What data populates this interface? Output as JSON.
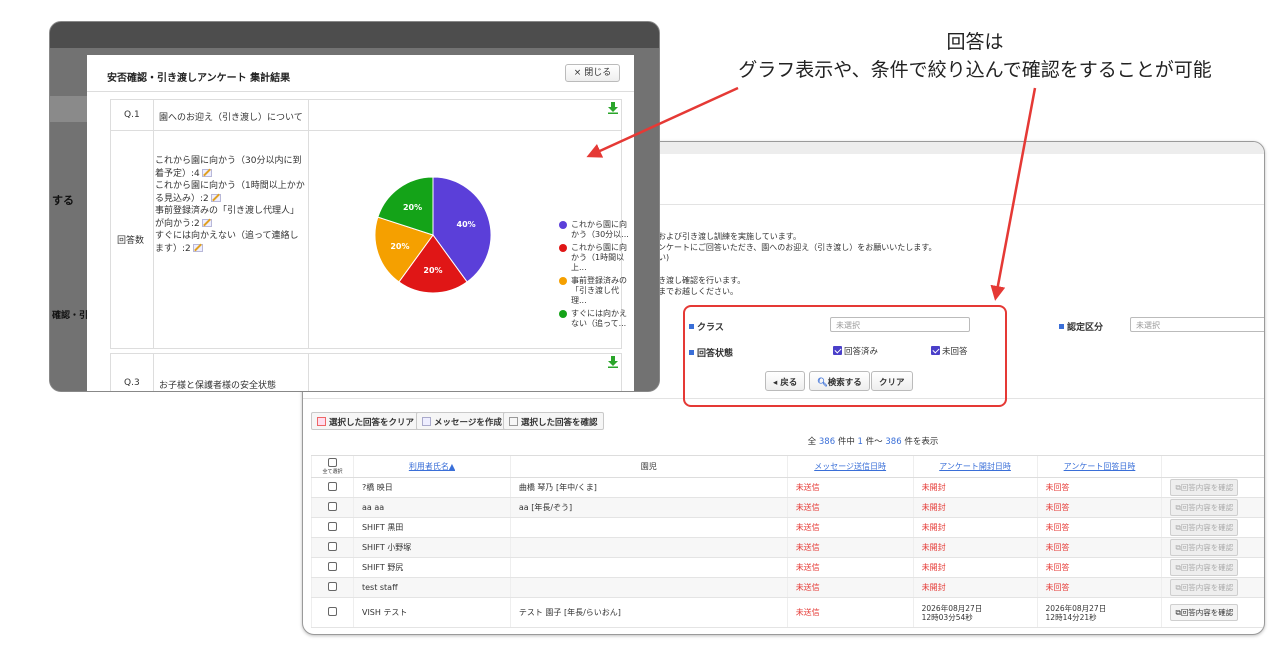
{
  "annotation": {
    "line1": "回答は",
    "line2": "グラフ表示や、条件で絞り込んで確認をすることが可能"
  },
  "colors": {
    "accent": "#e53935",
    "link": "#3a6fd8",
    "purple": "#4a3fc9"
  },
  "list_screen": {
    "info_lines": [
      "および引き渡し訓練を実施しています。",
      "ンケートにご回答いただき、園へのお迎え（引き渡し）をお願いいたします。",
      "い)"
    ],
    "info_lines2": [
      "き渡し確認を行います。",
      "までお越しください。"
    ],
    "filter": {
      "class_label": "クラス",
      "class_placeholder": "未選択",
      "cert_label": "認定区分",
      "cert_placeholder": "未選択",
      "status_label": "回答状態",
      "answered": "回答済み",
      "unanswered": "未回答",
      "back": "戻る",
      "search": "検索する",
      "clear": "クリア"
    },
    "toolbar": {
      "clear_selected": "選択した回答をクリア",
      "create_message": "メッセージを作成",
      "confirm_selected": "選択した回答を確認"
    },
    "count": {
      "pre": "全",
      "total": "386",
      "mid1": "件中",
      "from": "1",
      "mid2": "件～",
      "to": "386",
      "post": "件を表示"
    },
    "columns": {
      "select_all": "全て選択",
      "user_name": "利用者氏名▲",
      "child": "園児",
      "msg_sent": "メッセージ送信日時",
      "opened": "アンケート開封日時",
      "answered_at": "アンケート回答日時"
    },
    "rows": [
      {
        "name": "?橋 映日",
        "child": "曲橋 琴乃 [年中/くま]",
        "sent": "未送信",
        "opened": "未開封",
        "answered": "未回答",
        "btn": "回答内容を確認"
      },
      {
        "name": "aa aa",
        "child": "aa [年長/ぞう]",
        "sent": "未送信",
        "opened": "未開封",
        "answered": "未回答",
        "btn": "回答内容を確認"
      },
      {
        "name": "SHIFT 黒田",
        "child": "",
        "sent": "未送信",
        "opened": "未開封",
        "answered": "未回答",
        "btn": "回答内容を確認"
      },
      {
        "name": "SHIFT 小野塚",
        "child": "",
        "sent": "未送信",
        "opened": "未開封",
        "answered": "未回答",
        "btn": "回答内容を確認"
      },
      {
        "name": "SHIFT 野尻",
        "child": "",
        "sent": "未送信",
        "opened": "未開封",
        "answered": "未回答",
        "btn": "回答内容を確認"
      },
      {
        "name": "test staff",
        "child": "",
        "sent": "未送信",
        "opened": "未開封",
        "answered": "未回答",
        "btn": "回答内容を確認"
      },
      {
        "name": "VISH テスト",
        "child": "テスト 園子 [年長/らいおん]",
        "sent": "未送信",
        "opened": "2026年08月27日",
        "opened2": "12時03分54秒",
        "answered": "2026年08月27日",
        "answered2": "12時14分21秒",
        "btn": "回答内容を確認"
      }
    ]
  },
  "modal_backdrop": {
    "text1": "する",
    "text2": "確認・引"
  },
  "modal": {
    "title": "安否確認・引き渡しアンケート 集計結果",
    "close": "× 閉じる",
    "q1": {
      "num": "Q.1",
      "text": "園へのお迎え（引き渡し）について",
      "answer_label": "回答数",
      "answers": [
        "これから園に向かう（30分以内に到着予定）:4",
        "これから園に向かう（1時間以上かかる見込み）:2",
        "事前登録済みの「引き渡し代理人」が向かう:2",
        "すぐには向かえない（追って連絡します）:2"
      ]
    },
    "q3": {
      "num": "Q.3",
      "text": "お子様と保護者様の安全状態"
    }
  },
  "chart_data": {
    "type": "pie",
    "categories": [
      "これから園に向かう（30分以...",
      "これから園に向かう（1時間以上...",
      "事前登録済みの「引き渡し代理...",
      "すぐには向かえない（追って..."
    ],
    "values": [
      40,
      20,
      20,
      20
    ],
    "labels": [
      "40%",
      "20%",
      "20%",
      "20%"
    ],
    "colors": [
      "#5b3fd9",
      "#e01616",
      "#f5a000",
      "#14a318"
    ],
    "legend": "right"
  }
}
